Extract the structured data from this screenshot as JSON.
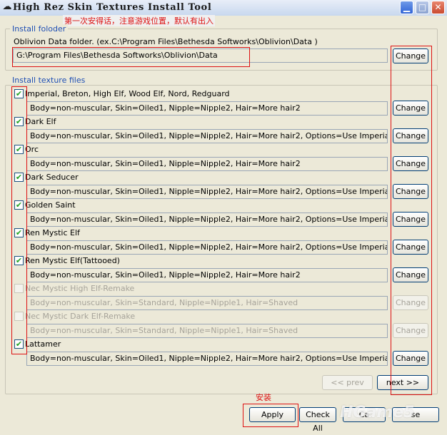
{
  "window": {
    "title": "High Rez Skin Textures Install Tool",
    "annotation_top": "第一次安得话，注意游戏位置，默认有出入",
    "annotation_apply": "安装"
  },
  "install_folder": {
    "group_label": "Install foloder",
    "description": "Oblivion Data folder. (ex.C:\\Program Files\\Bethesda Softworks\\Oblivion\\Data )",
    "path": "G:\\Program Files\\Bethesda Softworks\\Oblivion\\Data",
    "change_label": "Change"
  },
  "textures": {
    "group_label": "Install texture files",
    "items": [
      {
        "label": "Imperial, Breton, High Elf, Wood Elf, Nord, Redguard",
        "checked": true,
        "enabled": true,
        "option": "Body=non-muscular, Skin=Oiled1, Nipple=Nipple2, Hair=More hair2",
        "change": "Change"
      },
      {
        "label": "Dark Elf",
        "checked": true,
        "enabled": true,
        "option": "Body=non-muscular, Skin=Oiled1, Nipple=Nipple2, Hair=More hair2, Options=Use Imperial textures",
        "change": "Change"
      },
      {
        "label": "Orc",
        "checked": true,
        "enabled": true,
        "option": "Body=non-muscular, Skin=Oiled1, Nipple=Nipple2, Hair=More hair2",
        "change": "Change"
      },
      {
        "label": "Dark Seducer",
        "checked": true,
        "enabled": true,
        "option": "Body=non-muscular, Skin=Oiled1, Nipple=Nipple2, Hair=More hair2, Options=Use Imperial textures",
        "change": "Change"
      },
      {
        "label": "Golden Saint",
        "checked": true,
        "enabled": true,
        "option": "Body=non-muscular, Skin=Oiled1, Nipple=Nipple2, Hair=More hair2, Options=Use Imperial textures",
        "change": "Change"
      },
      {
        "label": "Ren Mystic Elf",
        "checked": true,
        "enabled": true,
        "option": "Body=non-muscular, Skin=Oiled1, Nipple=Nipple2, Hair=More hair2, Options=Use Imperial textures",
        "change": "Change"
      },
      {
        "label": "Ren Mystic Elf(Tattooed)",
        "checked": true,
        "enabled": true,
        "option": "Body=non-muscular, Skin=Oiled1, Nipple=Nipple2, Hair=More hair2",
        "change": "Change"
      },
      {
        "label": "Nec Mystic High Elf-Remake",
        "checked": false,
        "enabled": false,
        "option": "Body=non-muscular, Skin=Standard, Nipple=Nipple1, Hair=Shaved",
        "change": "Change"
      },
      {
        "label": "Nec Mystic Dark Elf-Remake",
        "checked": false,
        "enabled": false,
        "option": "Body=non-muscular, Skin=Standard, Nipple=Nipple1, Hair=Shaved",
        "change": "Change"
      },
      {
        "label": "Lattamer",
        "checked": true,
        "enabled": true,
        "option": "Body=non-muscular, Skin=Oiled1, Nipple=Nipple2, Hair=More hair2, Options=Use Imperial textures",
        "change": "Change"
      }
    ],
    "prev_label": "<< prev",
    "next_label": "next >>"
  },
  "footer": {
    "apply_label": "Apply",
    "check_all_label": "Check All",
    "cancel_label": "Ca",
    "close_label": "se"
  },
  "watermark": "HGame5",
  "colors": {
    "annotation_red": "#dd1111",
    "group_label_blue": "#1f4fb4",
    "check_green": "#21a121"
  }
}
